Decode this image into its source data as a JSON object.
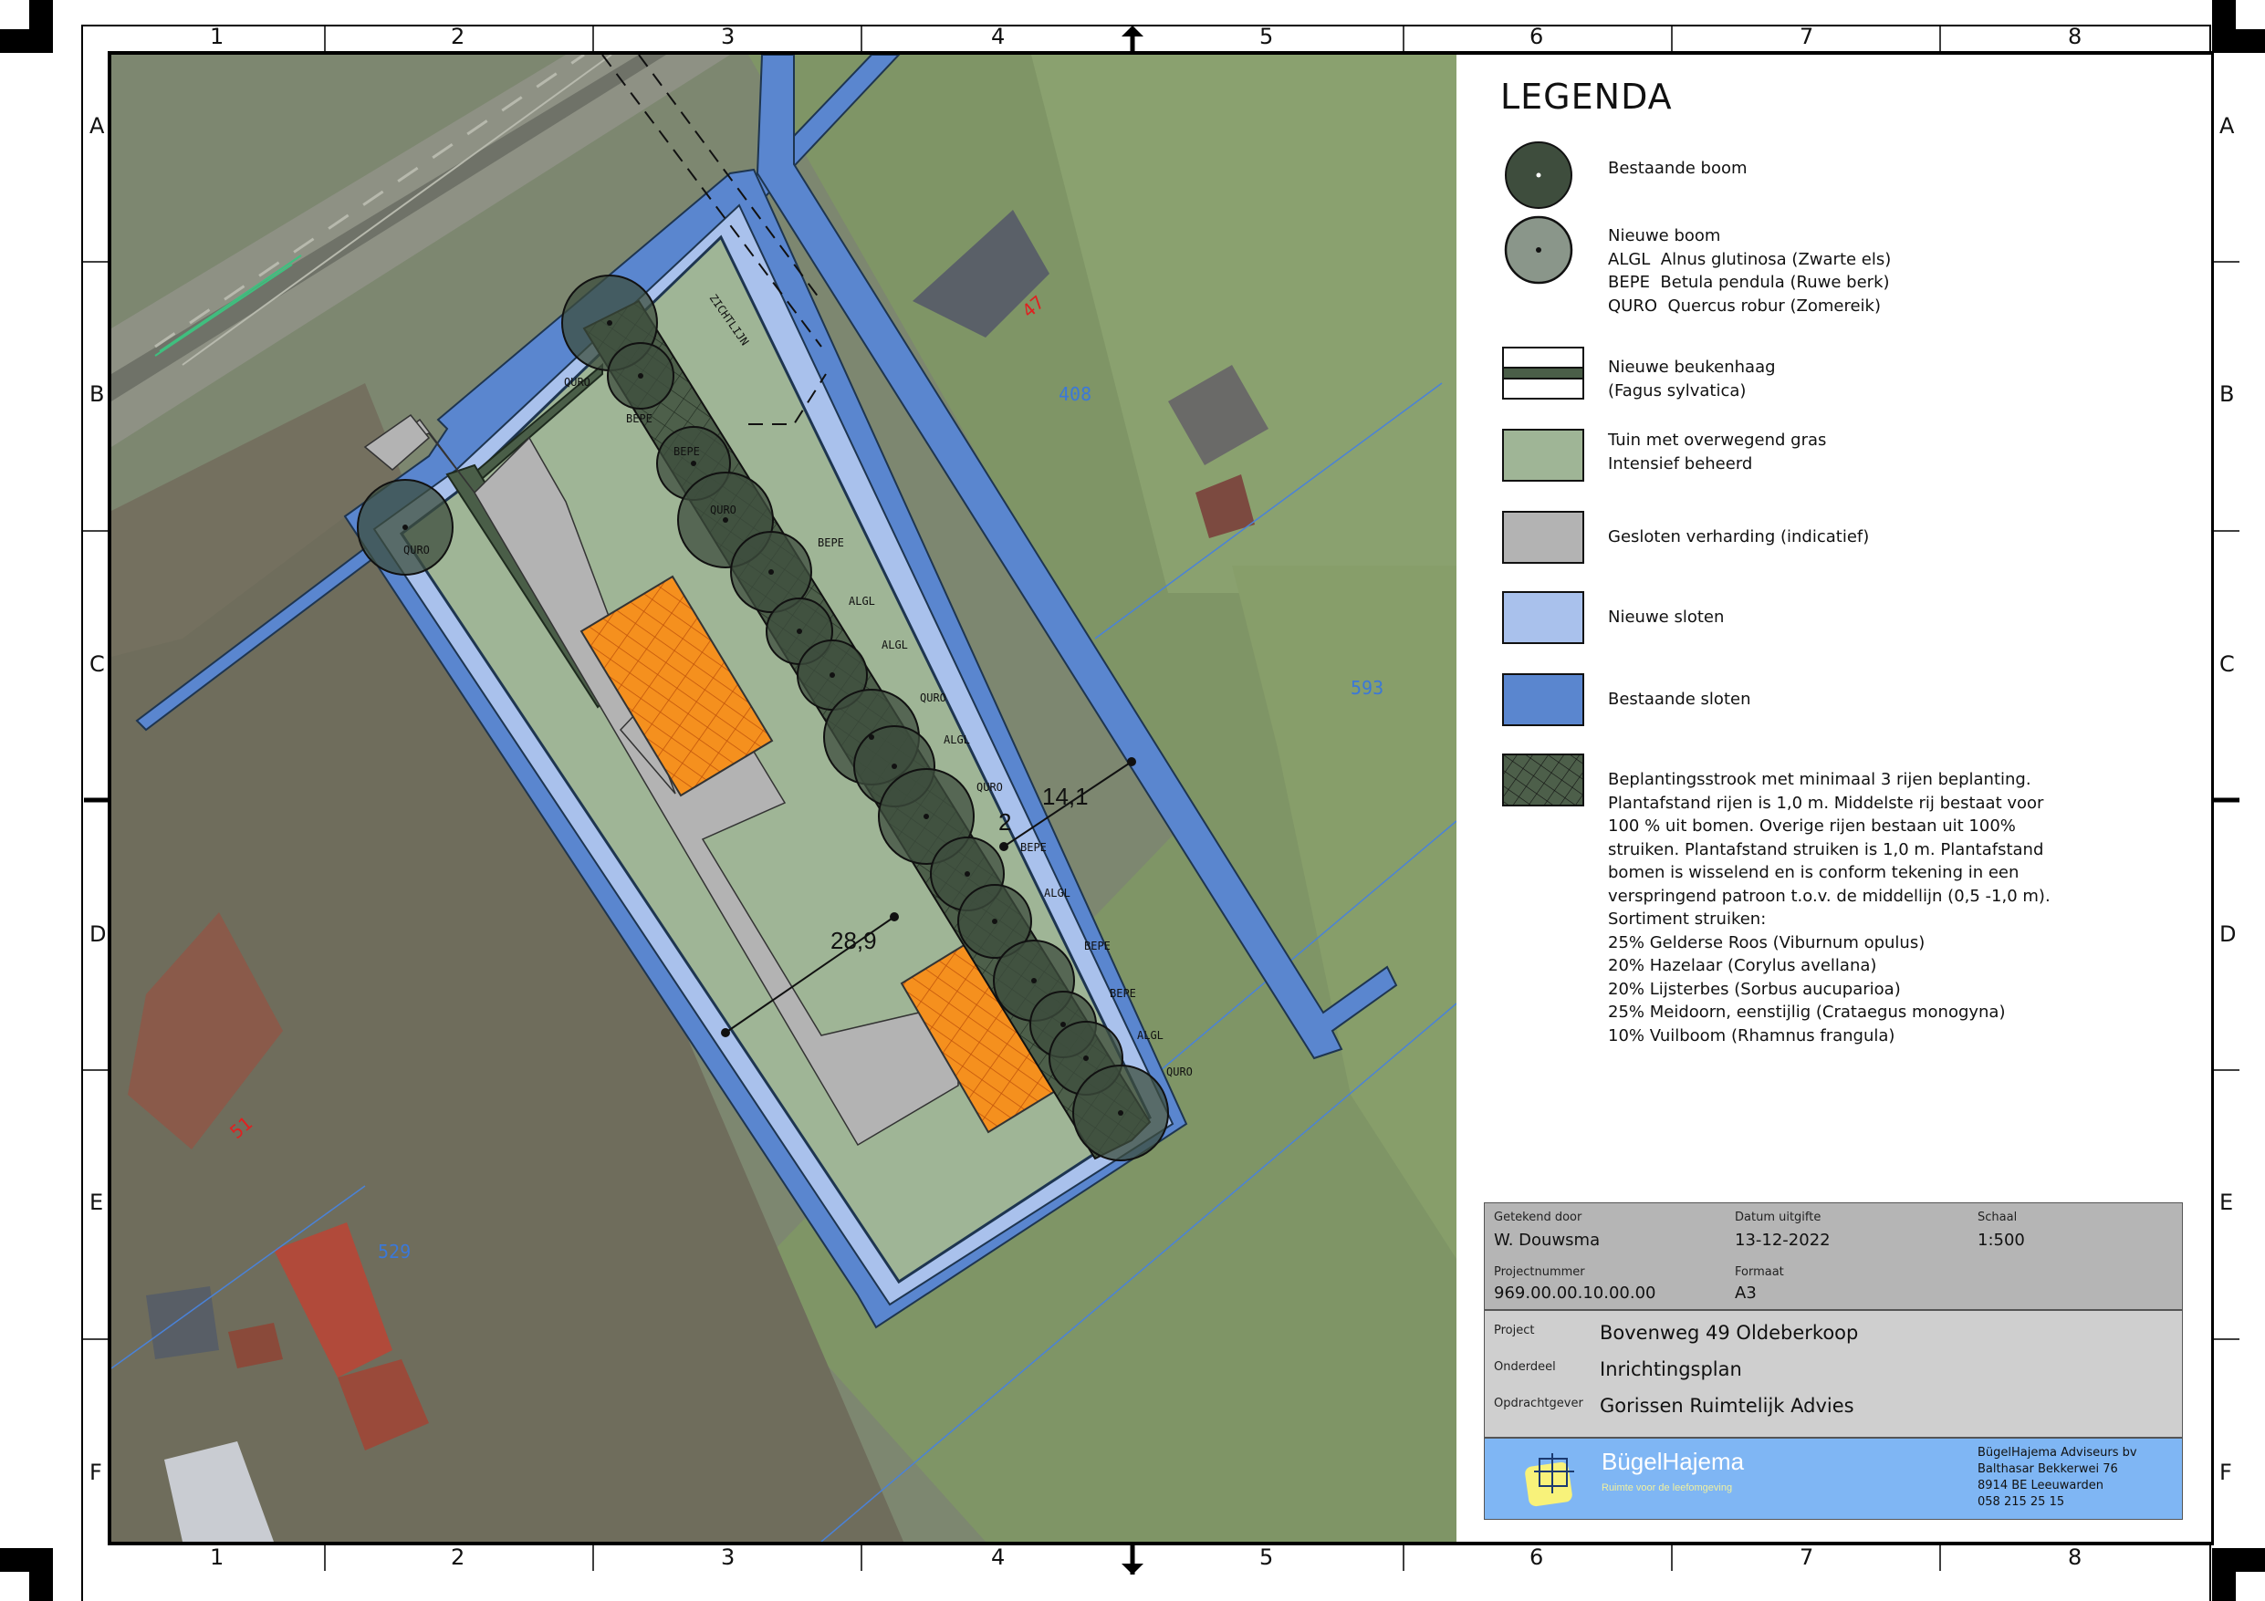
{
  "grid": {
    "columns": [
      "1",
      "2",
      "3",
      "4",
      "5",
      "6",
      "7",
      "8"
    ],
    "rows": [
      "A",
      "B",
      "C",
      "D",
      "E",
      "F"
    ]
  },
  "map": {
    "labels": {
      "quro1": "QURO",
      "quro2": "QURO",
      "bepe1": "BEPE",
      "bepe2": "BEPE",
      "quro3": "QURO",
      "bepe3": "BEPE",
      "algl1": "ALGL",
      "algl2": "ALGL",
      "quro4": "QURO",
      "algl3": "ALGL",
      "quro5": "QURO",
      "bepe4": "BEPE",
      "algl4": "ALGL",
      "bepe5": "BEPE",
      "bepe6": "BEPE",
      "algl5": "ALGL",
      "quro6": "QURO",
      "zichtlijn": "ZICHTLIJN"
    },
    "dims": {
      "d1": "14,1",
      "d2": "2",
      "d3": "28,9"
    },
    "parcels": {
      "p47": "47",
      "p51": "51",
      "p408": "408",
      "p593": "593",
      "p529": "529"
    }
  },
  "legend": {
    "title": "LEGENDA",
    "items": [
      {
        "text": "Bestaande boom"
      },
      {
        "text": "Nieuwe boom\nALGL  Alnus glutinosa (Zwarte els)\nBEPE  Betula pendula (Ruwe berk)\nQURO  Quercus robur (Zomereik)"
      },
      {
        "text": "Nieuwe beukenhaag\n(Fagus sylvatica)"
      },
      {
        "text": "Tuin met overwegend gras\nIntensief beheerd"
      },
      {
        "text": "Gesloten verharding (indicatief)"
      },
      {
        "text": "Nieuwe sloten"
      },
      {
        "text": "Bestaande sloten"
      },
      {
        "text": "Beplantingsstrook met minimaal 3 rijen beplanting.\nPlantafstand rijen is 1,0 m. Middelste rij bestaat voor\n100 % uit bomen. Overige rijen bestaan uit 100%\nstruiken. Plantafstand struiken is 1,0 m. Plantafstand\nbomen is wisselend en is conform tekening in een\nverspringend patroon t.o.v. de middellijn (0,5 -1,0 m).\nSortiment struiken:\n25% Gelderse Roos (Viburnum opulus)\n20% Hazelaar (Corylus avellana)\n20% Lijsterbes (Sorbus aucuparioa)\n25% Meidoorn, eenstijlig (Crataegus monogyna)\n10% Vuilboom (Rhamnus frangula)"
      }
    ]
  },
  "titleblock": {
    "getekend_label": "Getekend door",
    "getekend_value": "W. Douwsma",
    "datum_label": "Datum uitgifte",
    "datum_value": "13-12-2022",
    "schaal_label": "Schaal",
    "schaal_value": "1:500",
    "projectnummer_label": "Projectnummer",
    "projectnummer_value": "969.00.00.10.00.00",
    "formaat_label": "Formaat",
    "formaat_value": "A3",
    "project_label": "Project",
    "project_value": "Bovenweg 49 Oldeberkoop",
    "onderdeel_label": "Onderdeel",
    "onderdeel_value": "Inrichtingsplan",
    "opdrachtgever_label": "Opdrachtgever",
    "opdrachtgever_value": "Gorissen Ruimtelijk Advies",
    "company_name": "BügelHajema",
    "company_tagline": "Ruimte voor de leefomgeving",
    "address1": "BügelHajema Adviseurs bv",
    "address2": "Balthasar Bekkerwei 76",
    "address3": "8914 BE Leeuwarden",
    "address4": "058 215 25 15"
  },
  "colors": {
    "grass_garden": "#9fb596",
    "paving": "#b3b3b3",
    "new_ditch": "#a9c1ec",
    "existing_ditch": "#5a86cf",
    "hedge": "#4a5e48",
    "tree": "#3e4d3d",
    "orange": "#f5901e"
  }
}
